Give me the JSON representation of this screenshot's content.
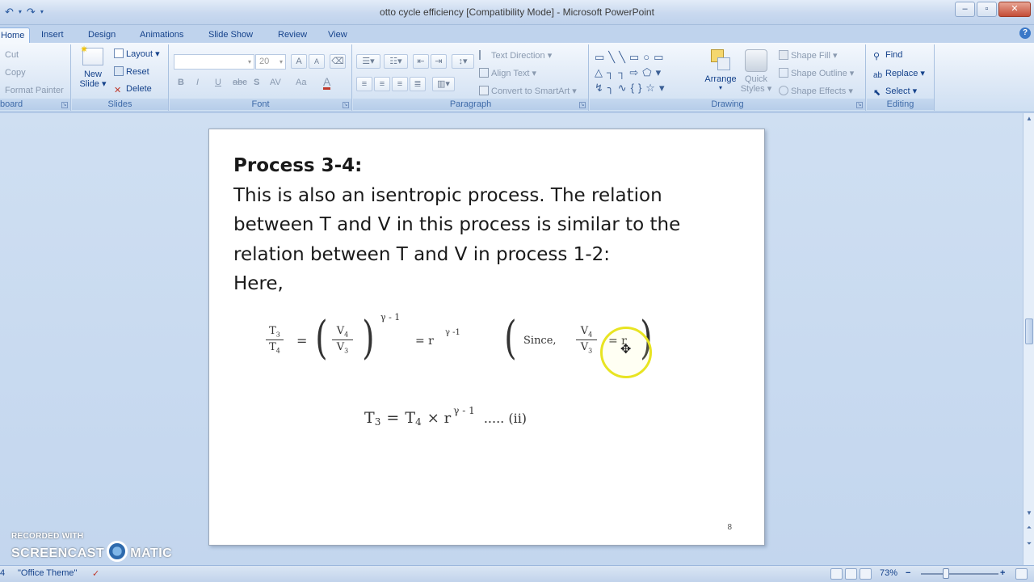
{
  "window": {
    "title": "otto cycle efficiency [Compatibility Mode] - Microsoft PowerPoint",
    "quick_access": [
      "undo-icon",
      "dropdown-icon",
      "redo-icon",
      "customize-icon"
    ]
  },
  "tabs": [
    "Home",
    "Insert",
    "Design",
    "Animations",
    "Slide Show",
    "Review",
    "View"
  ],
  "active_tab": "Home",
  "ribbon": {
    "clipboard": {
      "cut": "Cut",
      "copy": "Copy",
      "format_painter": "Format Painter",
      "label": "board"
    },
    "slides": {
      "new_slide": "New",
      "new_slide_2": "Slide",
      "layout": "Layout",
      "reset": "Reset",
      "delete": "Delete",
      "label": "Slides"
    },
    "font": {
      "size": "20",
      "bold": "B",
      "italic": "I",
      "underline": "U",
      "strike": "abc",
      "shadow": "S",
      "spacing": "AV",
      "case": "Aa",
      "color": "A",
      "grow": "A",
      "shrink": "A",
      "label": "Font"
    },
    "paragraph": {
      "text_direction": "Text Direction",
      "align_text": "Align Text",
      "convert_smartart": "Convert to SmartArt",
      "label": "Paragraph"
    },
    "drawing": {
      "arrange": "Arrange",
      "quick_styles": "Quick",
      "quick_styles_2": "Styles",
      "shape_fill": "Shape Fill",
      "shape_outline": "Shape Outline",
      "shape_effects": "Shape Effects",
      "label": "Drawing"
    },
    "editing": {
      "find": "Find",
      "replace": "Replace",
      "select": "Select",
      "label": "Editing"
    }
  },
  "slide": {
    "heading": "Process 3-4:",
    "lines": [
      "This is also an isentropic process. The relation",
      "between T and V in this process is similar to the",
      "relation between T and V in process 1-2:",
      "Here,"
    ],
    "eq1": {
      "t3": "T",
      "t3_sub": "3",
      "t4": "T",
      "t4_sub": "4",
      "eq": "=",
      "v4": "V",
      "v4_sub": "4",
      "v3": "V",
      "v3_sub": "3",
      "exp": "γ - 1",
      "eq2": "= r",
      "exp2": "γ -1",
      "since": "Since,",
      "v4b": "V",
      "v4b_sub": "4",
      "v3b": "V",
      "v3b_sub": "3",
      "eq3": "= r"
    },
    "eq2": {
      "t3": "T",
      "t3_sub": "3",
      "eq": "=",
      "t4": "T",
      "t4_sub": "4",
      "times": "× r",
      "exp": "γ - 1",
      "tail": "..... (ii)"
    },
    "number": "8"
  },
  "watermark": {
    "line1": "RECORDED WITH",
    "line2a": "SCREENCAST",
    "line2b": "MATIC"
  },
  "status": {
    "slide_info": "4",
    "theme": "\"Office Theme\"",
    "zoom": "73%"
  }
}
